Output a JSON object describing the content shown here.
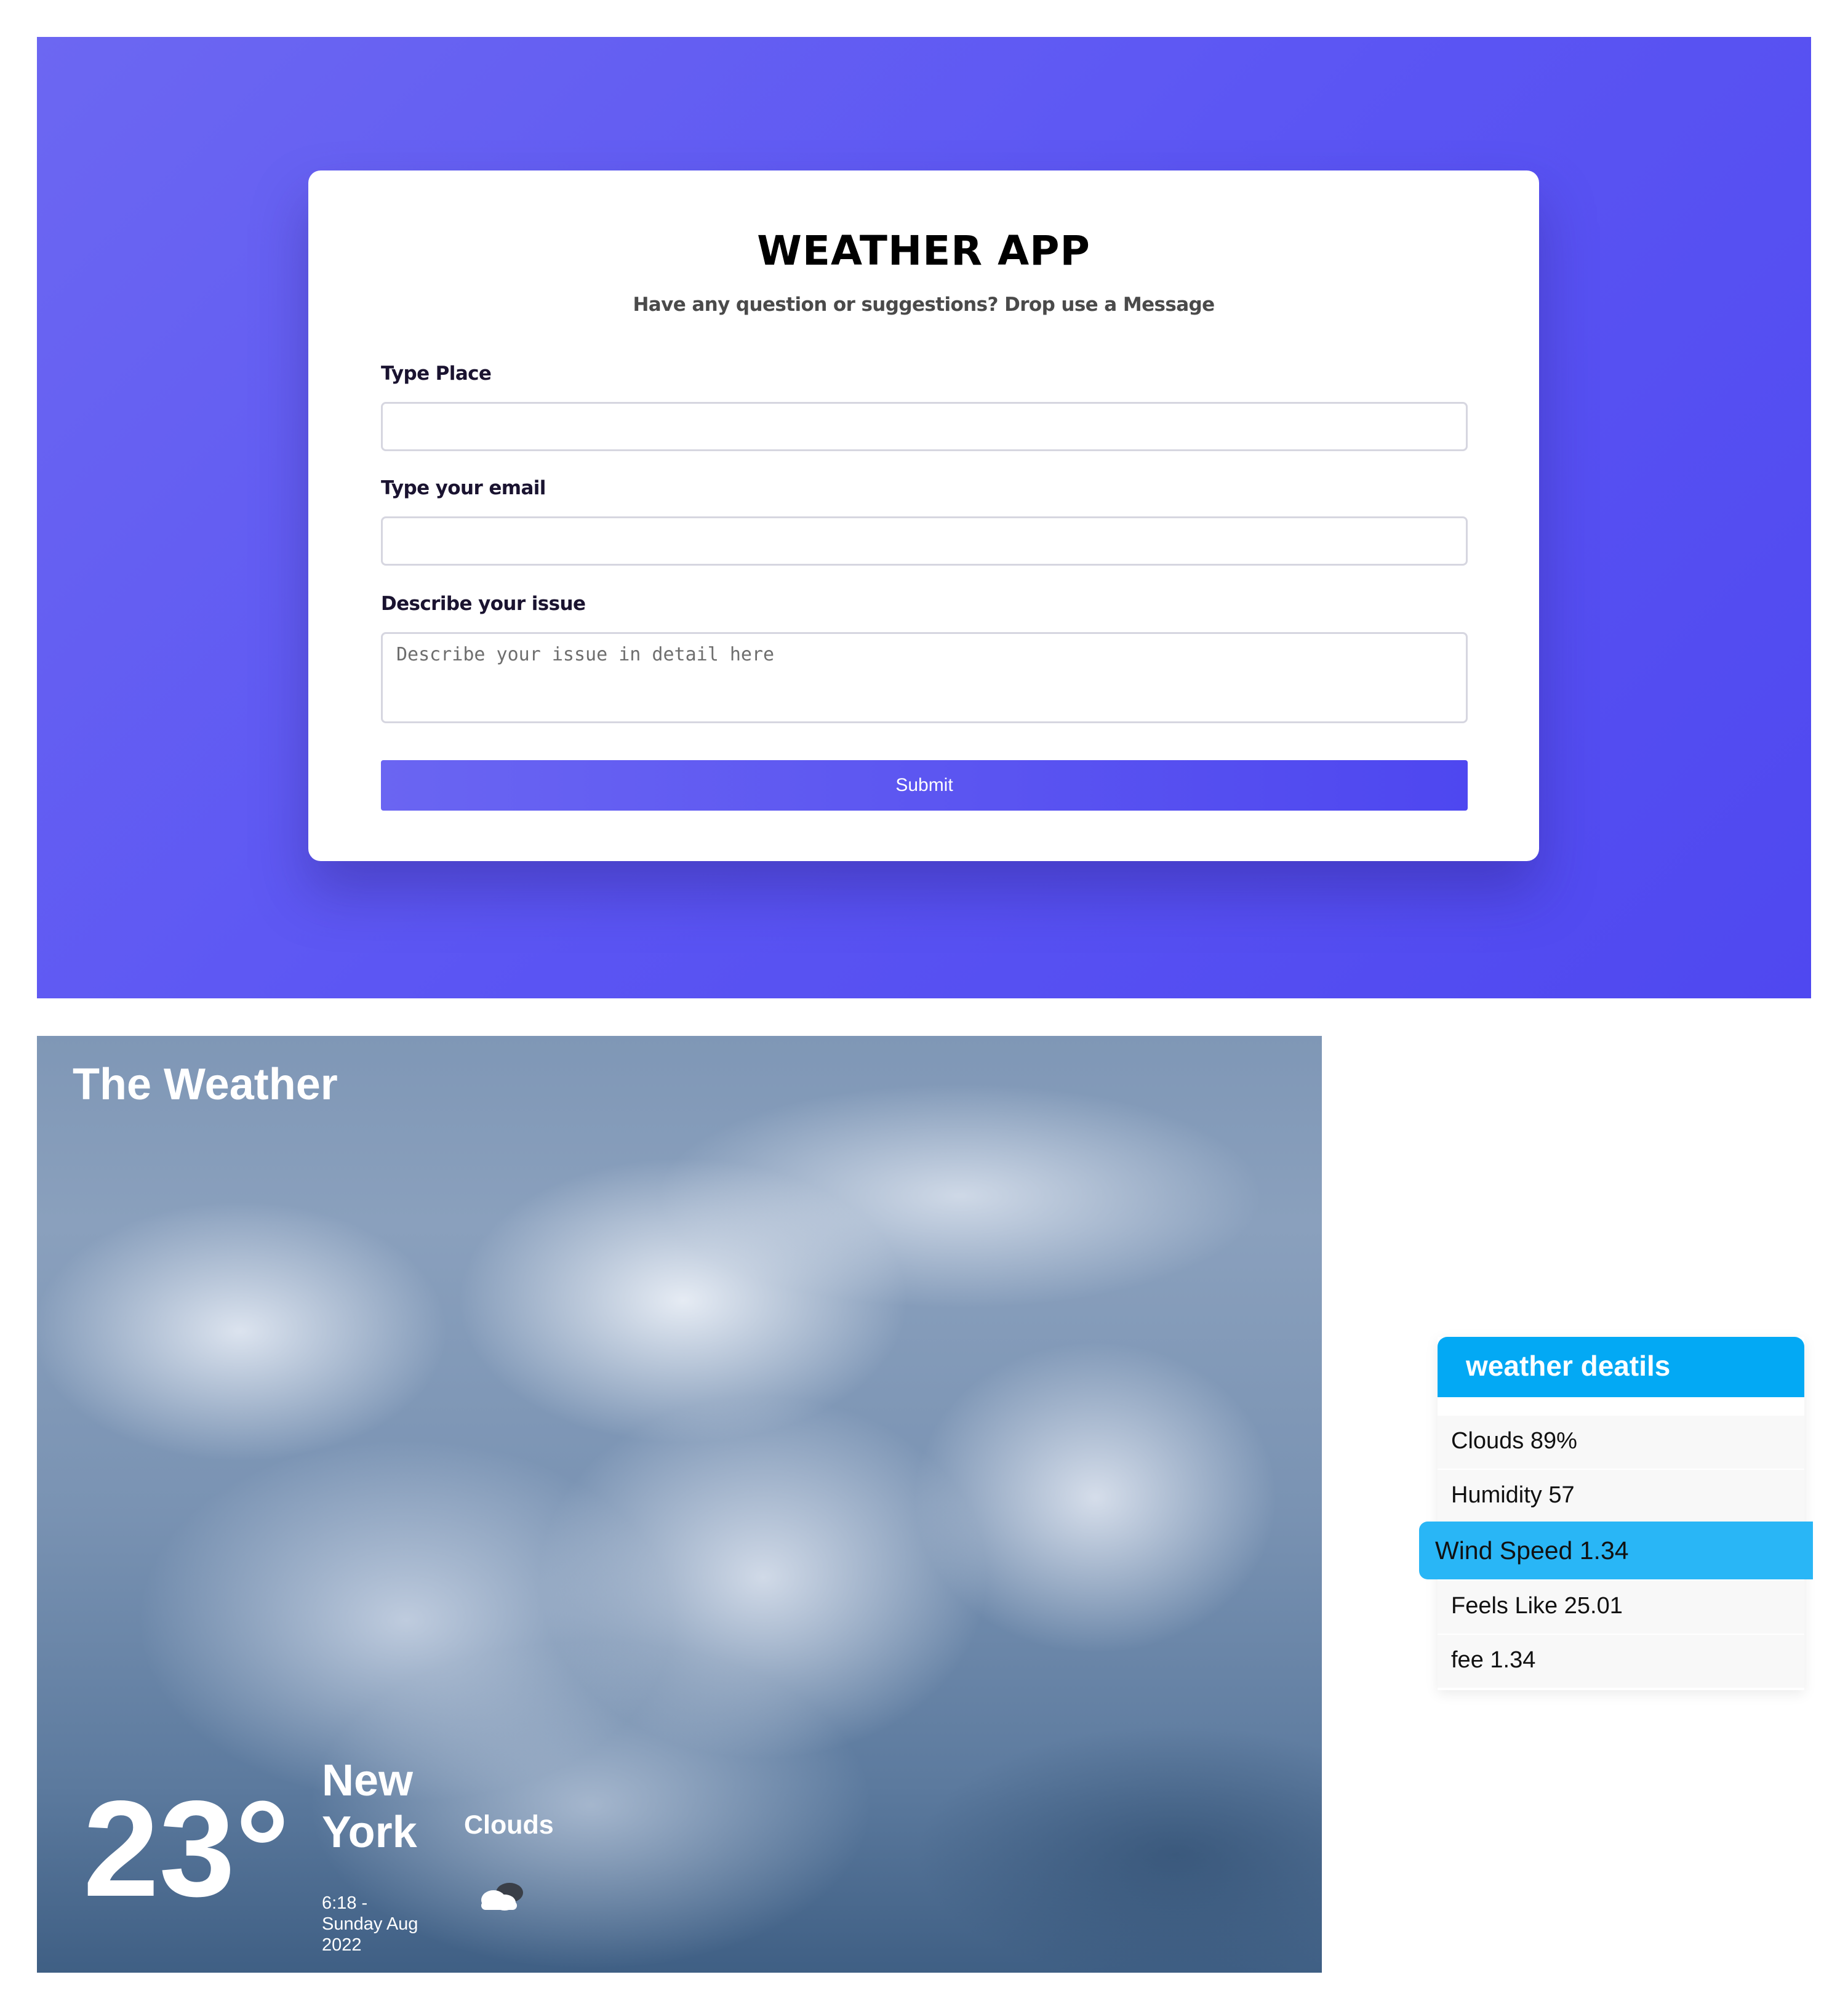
{
  "contact": {
    "title": "WEATHER APP",
    "subtitle": "Have any question or suggestions? Drop use a Message",
    "place_label": "Type Place",
    "place_value": "",
    "email_label": "Type your email",
    "email_value": "",
    "issue_label": "Describe your issue",
    "issue_placeholder": "Describe your issue in detail here",
    "submit_label": "Submit",
    "colors": {
      "gradient_start": "#6c67f2",
      "gradient_end": "#4f48f0",
      "card": "#ffffff"
    }
  },
  "weather": {
    "heading": "The Weather",
    "temperature": "23°",
    "city": "New York",
    "datetime": "6:18 - Sunday Aug 2022",
    "condition": "Clouds",
    "condition_icon": "cloud-icon"
  },
  "details": {
    "title": "weather deatils",
    "items": [
      {
        "label": "Clouds 89%"
      },
      {
        "label": "Humidity 57"
      },
      {
        "label": "Wind Speed 1.34"
      },
      {
        "label": "Feels Like 25.01"
      },
      {
        "label": "fee 1.34"
      }
    ],
    "active_index": 2,
    "colors": {
      "header": "#03a9f4",
      "active": "#29b6f6"
    }
  }
}
